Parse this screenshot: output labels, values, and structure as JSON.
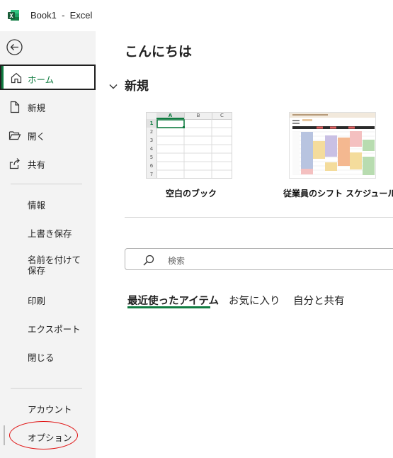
{
  "titlebar": {
    "app_icon": "excel-logo",
    "title": "Book1  -  Excel"
  },
  "sidebar": {
    "back_icon": "back-arrow-icon",
    "items": [
      {
        "key": "home",
        "label": "ホーム",
        "icon": "home-icon"
      },
      {
        "key": "new",
        "label": "新規",
        "icon": "new-file-icon"
      },
      {
        "key": "open",
        "label": "開く",
        "icon": "open-folder-icon"
      },
      {
        "key": "share",
        "label": "共有",
        "icon": "share-icon"
      },
      {
        "key": "info",
        "label": "情報"
      },
      {
        "key": "save",
        "label": "上書き保存"
      },
      {
        "key": "saveas",
        "label": "名前を付けて保存"
      },
      {
        "key": "print",
        "label": "印刷"
      },
      {
        "key": "export",
        "label": "エクスポート"
      },
      {
        "key": "close",
        "label": "閉じる"
      },
      {
        "key": "account",
        "label": "アカウント"
      },
      {
        "key": "options",
        "label": "オプション"
      }
    ],
    "accent_color": "#107c41",
    "highlight_color": "#e01010"
  },
  "main": {
    "greeting": "こんにちは",
    "new_section": {
      "title": "新規",
      "chevron_icon": "chevron-down-icon"
    },
    "templates": [
      {
        "label": "空白のブック",
        "grid": {
          "columns": [
            "A",
            "B",
            "C"
          ],
          "rows": [
            "1",
            "2",
            "3",
            "4",
            "5",
            "6",
            "7"
          ]
        }
      },
      {
        "label": "従業員のシフト スケジュール"
      }
    ],
    "search": {
      "placeholder": "検索",
      "icon": "search-icon"
    },
    "tabs": [
      {
        "label": "最近使ったアイテム",
        "active": true
      },
      {
        "label": "お気に入り",
        "active": false
      },
      {
        "label": "自分と共有",
        "active": false
      }
    ]
  }
}
